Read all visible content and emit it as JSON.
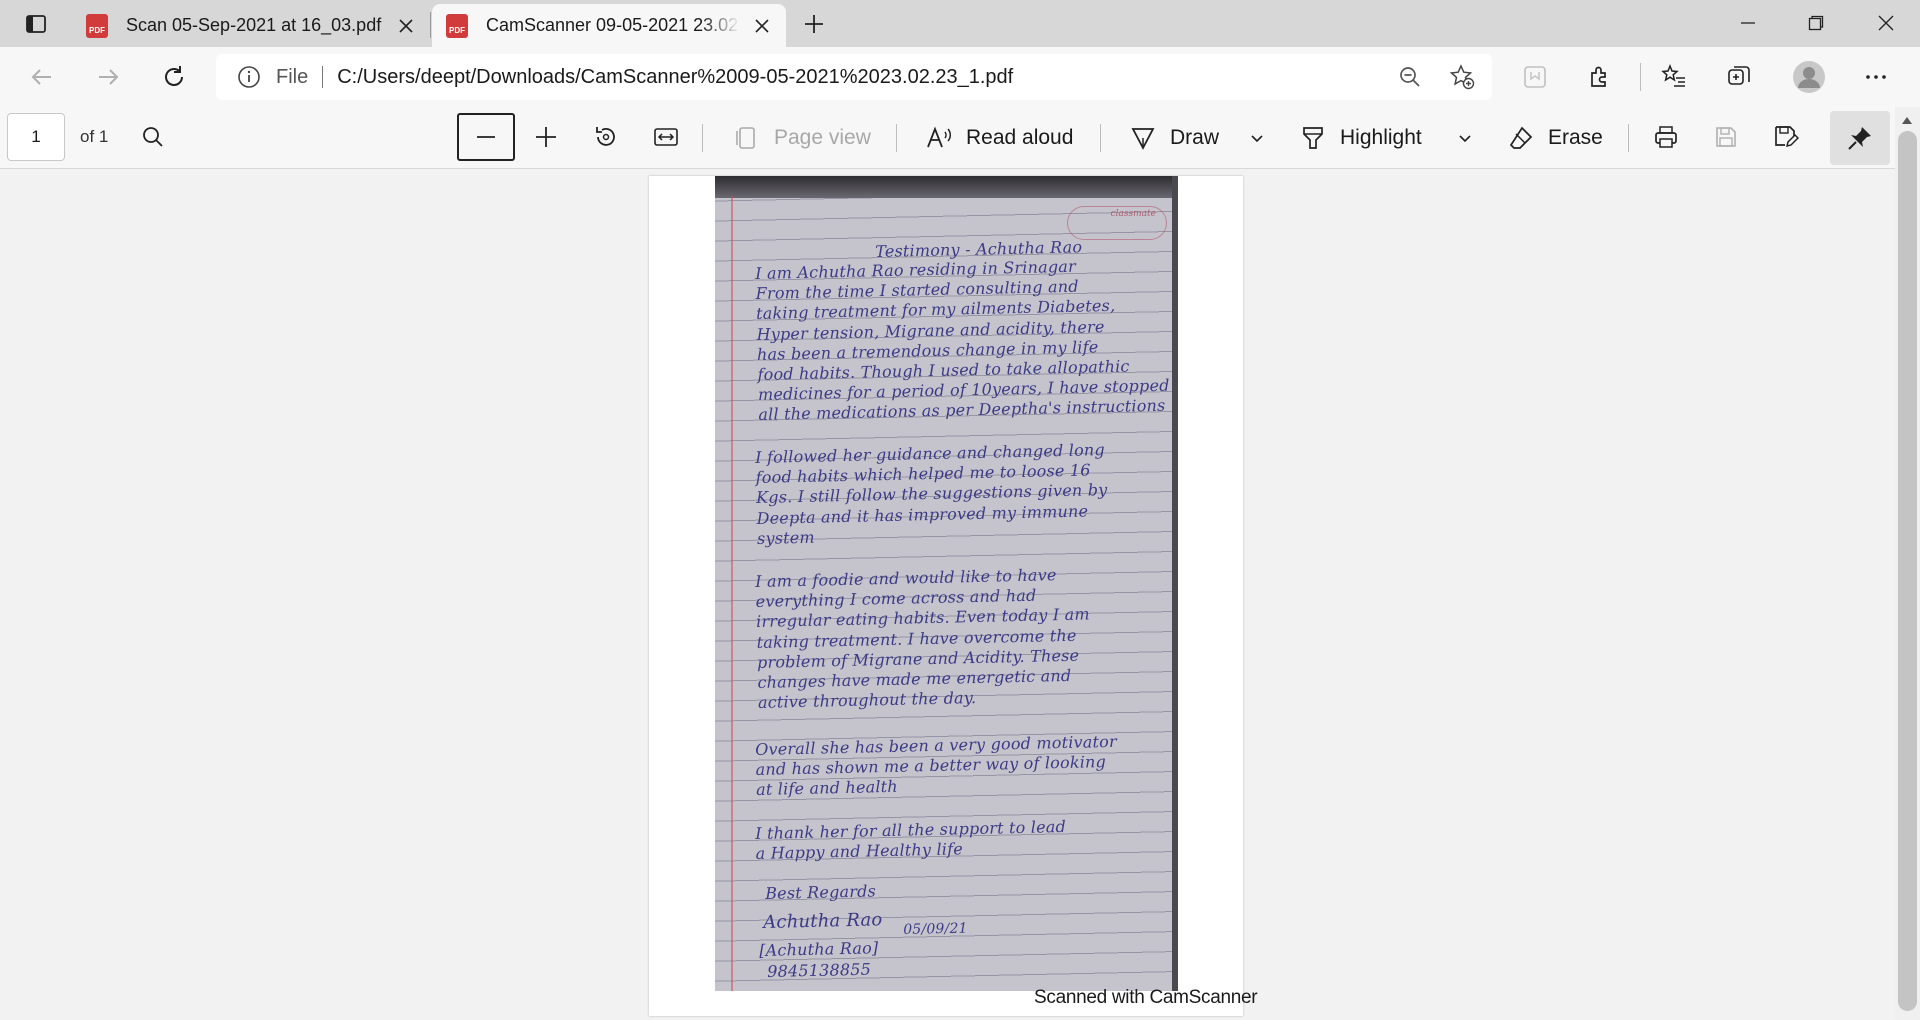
{
  "tabs": [
    {
      "title": "Scan 05-Sep-2021 at 16_03.pdf",
      "badge": "PDF",
      "active": false
    },
    {
      "title": "CamScanner 09-05-2021 23.02.23_1.pdf",
      "badge": "PDF",
      "active": true
    }
  ],
  "address_bar": {
    "scheme_label": "File",
    "url": "C:/Users/deept/Downloads/CamScanner%2009-05-2021%2023.02.23_1.pdf"
  },
  "pdf_toolbar": {
    "page_number": "1",
    "page_total": "of 1",
    "page_view_label": "Page view",
    "read_aloud_label": "Read aloud",
    "draw_label": "Draw",
    "highlight_label": "Highlight",
    "erase_label": "Erase"
  },
  "document": {
    "brand_mark": "classmate",
    "title": "Testimony - Achutha Rao",
    "paragraphs": [
      "I am Achutha Rao residing in Srinagar\nFrom the time I started consulting and\ntaking treatment for my ailments Diabetes,\nHyper tension, Migrane and acidity, there\nhas been a tremendous change in my life\nfood habits. Though I used to take allopathic\nmedicines for a period of 10years, I have stopped\nall the medications as per Deeptha's instructions",
      "I followed her guidance and changed long\nfood habits which helped me to loose 16\nKgs. I still follow the suggestions given by\nDeepta and it has improved my immune\nsystem",
      "I am a foodie and would like to have\neverything I come across and had\nirregular eating habits. Even today I am\ntaking treatment. I have overcome the\nproblem of Migrane and Acidity. These\nchanges have made me energetic and\nactive throughout the day.",
      "Overall she has been a very good motivator\nand has shown me a better way of looking\nat life and health",
      "I thank her for all the support to lead\na Happy and Healthy life"
    ],
    "closing": "Best Regards",
    "signature": "Achutha Rao",
    "date": "05/09/21",
    "name_line": "[Achutha Rao]",
    "phone": "9845138855",
    "caption": "Scanned with CamScanner"
  },
  "colors": {
    "ink": "#3b3a86",
    "pdf_badge": "#d23b3b",
    "tabstrip": "#d7d7d7"
  }
}
